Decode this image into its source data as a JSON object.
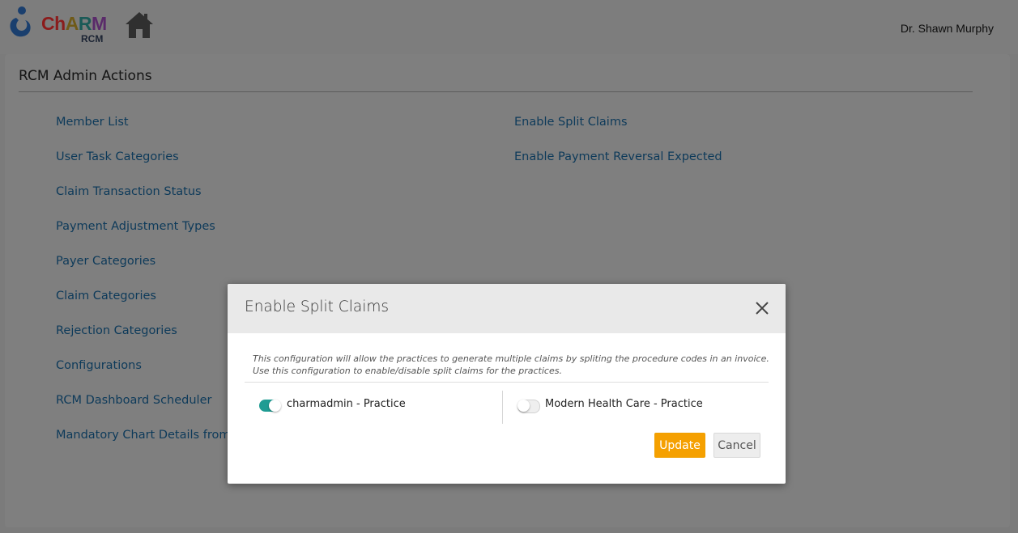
{
  "header": {
    "logo_text": "ChARM",
    "logo_sub": "RCM",
    "user_name": "Dr. Shawn Murphy"
  },
  "panel": {
    "title": "RCM Admin Actions",
    "left_links": [
      "Member List",
      "User Task Categories",
      "Claim Transaction Status",
      "Payment Adjustment Types",
      "Payer Categories",
      "Claim Categories",
      "Rejection Categories",
      "Configurations",
      "RCM Dashboard Scheduler",
      "Mandatory Chart Details from"
    ],
    "right_links": [
      "Enable Split Claims",
      "Enable Payment Reversal Expected"
    ]
  },
  "modal": {
    "title": "Enable Split Claims",
    "description_line1": "This configuration will allow the practices to generate multiple claims by spliting the procedure codes in an invoice.",
    "description_line2": "Use this configuration to enable/disable split claims for the practices.",
    "practices": [
      {
        "label": "charmadmin - Practice",
        "enabled": true
      },
      {
        "label": "Modern Health Care - Practice",
        "enabled": false
      }
    ],
    "update_label": "Update",
    "cancel_label": "Cancel"
  },
  "colors": {
    "toggle_on": "#1f9c93",
    "update_button": "#f5a000",
    "link": "#0d3a5a"
  },
  "icons": [
    "logo-icon",
    "home-icon",
    "close-icon"
  ]
}
